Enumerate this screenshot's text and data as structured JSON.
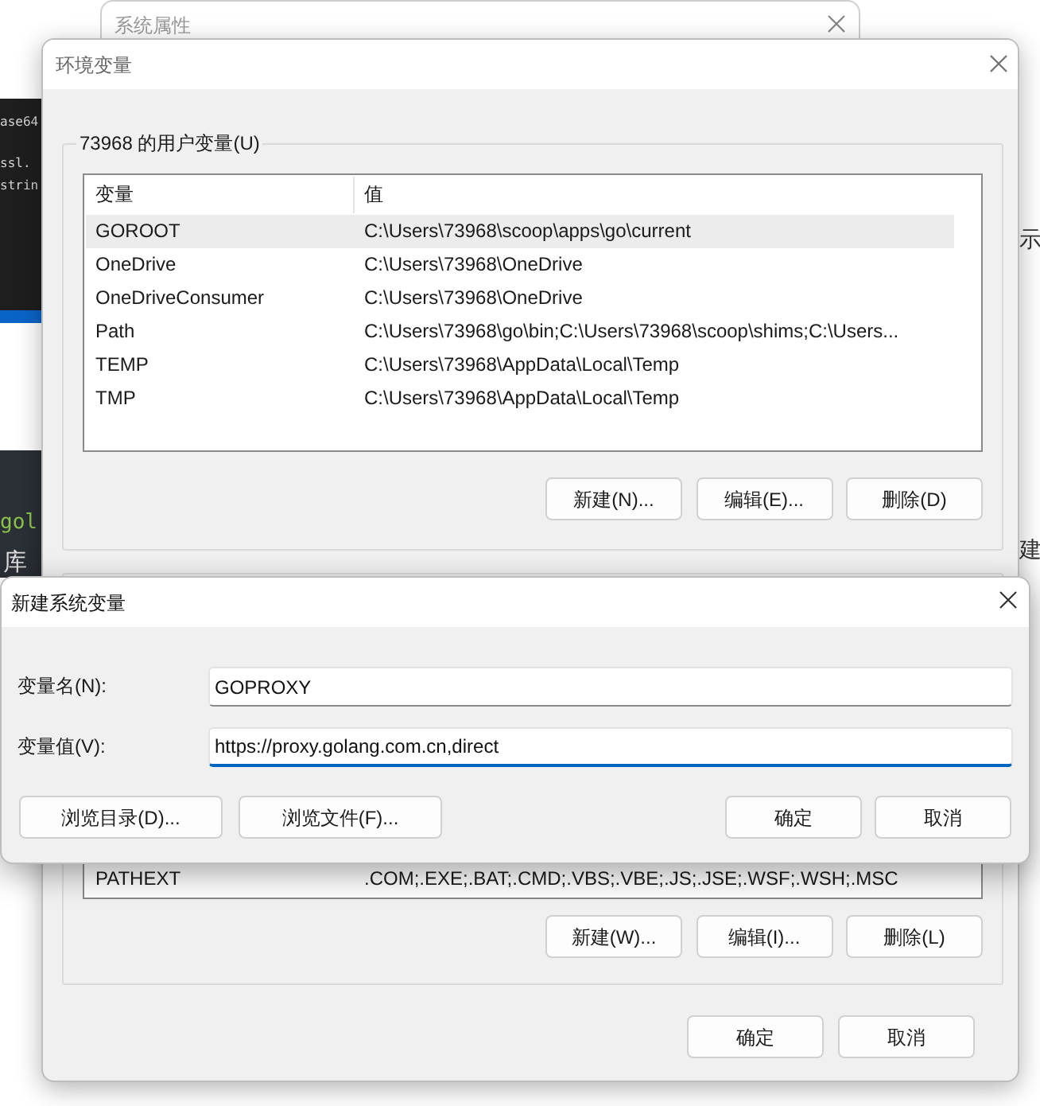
{
  "background": {
    "editor_lines": [
      "ase64",
      "ssl.",
      "strin"
    ],
    "code_fragment": "gol",
    "text_fragment": "库",
    "right_fragments": [
      "示",
      "建"
    ]
  },
  "system_properties": {
    "title": "系统属性"
  },
  "env_dialog": {
    "title": "环境变量",
    "user_group": {
      "title": "73968 的用户变量(U)",
      "columns": [
        "变量",
        "值"
      ],
      "rows": [
        {
          "name": "GOROOT",
          "value": "C:\\Users\\73968\\scoop\\apps\\go\\current",
          "selected": true
        },
        {
          "name": "OneDrive",
          "value": "C:\\Users\\73968\\OneDrive",
          "selected": false
        },
        {
          "name": "OneDriveConsumer",
          "value": "C:\\Users\\73968\\OneDrive",
          "selected": false
        },
        {
          "name": "Path",
          "value": "C:\\Users\\73968\\go\\bin;C:\\Users\\73968\\scoop\\shims;C:\\Users...",
          "selected": false
        },
        {
          "name": "TEMP",
          "value": "C:\\Users\\73968\\AppData\\Local\\Temp",
          "selected": false
        },
        {
          "name": "TMP",
          "value": "C:\\Users\\73968\\AppData\\Local\\Temp",
          "selected": false
        }
      ],
      "buttons": [
        "新建(N)...",
        "编辑(E)...",
        "删除(D)"
      ]
    },
    "system_group": {
      "rows": [
        {
          "name": "PATHEXT",
          "value": ".COM;.EXE;.BAT;.CMD;.VBS;.VBE;.JS;.JSE;.WSF;.WSH;.MSC",
          "selected": false
        }
      ],
      "buttons": [
        "新建(W)...",
        "编辑(I)...",
        "删除(L)"
      ]
    },
    "buttons": [
      "确定",
      "取消"
    ]
  },
  "new_var_dialog": {
    "title": "新建系统变量",
    "fields": [
      {
        "label": "变量名(N):",
        "value": "GOPROXY",
        "focused": false
      },
      {
        "label": "变量值(V):",
        "value": "https://proxy.golang.com.cn,direct",
        "focused": true
      }
    ],
    "browse_buttons": [
      "浏览目录(D)...",
      "浏览文件(F)..."
    ],
    "buttons": [
      "确定",
      "取消"
    ]
  }
}
